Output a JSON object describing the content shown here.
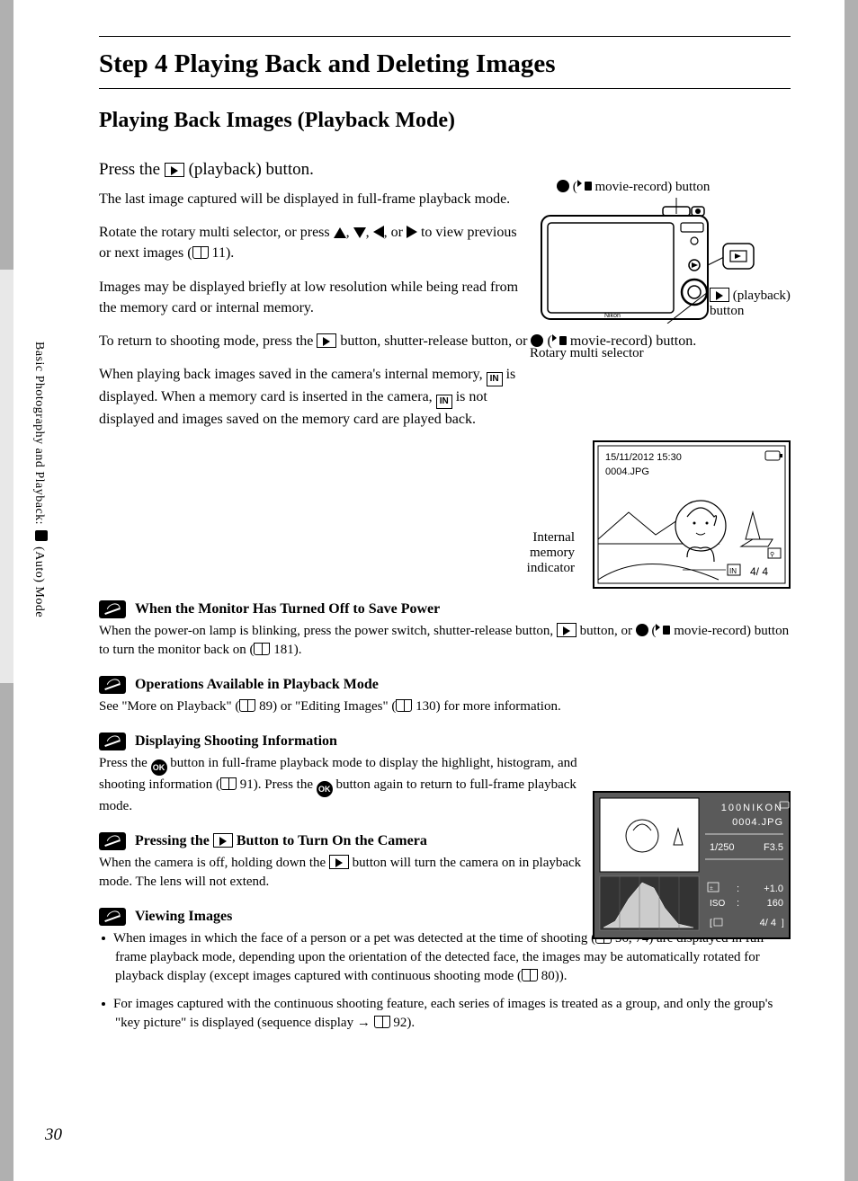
{
  "sidebar_text_1": "Basic Photography and Playback: ",
  "sidebar_text_2": " (Auto) Mode",
  "title": "Step 4 Playing Back and Deleting Images",
  "subtitle": "Playing Back Images (Playback Mode)",
  "step_heading_1": "Press the ",
  "step_heading_2": " (playback) button.",
  "p1": "The last image captured will be displayed in full-frame playback mode.",
  "p2a": "Rotate the rotary multi selector, or press ",
  "p2b": ", or ",
  "p2c": " to view previous or next images (",
  "p2d": " 11).",
  "p3": "Images may be displayed briefly at low resolution while being read from the memory card or internal memory.",
  "p4a": "To return to shooting mode, press the ",
  "p4b": " button, shutter-release button, or ",
  "p4c": " (",
  "p4d": " movie-record) button.",
  "p5a": "When playing back images saved in the camera's internal memory, ",
  "p5b": " is displayed. When a memory card is inserted in the camera, ",
  "p5c": " is not displayed and images saved on the memory card are played back.",
  "diagram": {
    "movie_button_1": " (",
    "movie_button_2": " movie-record) button",
    "playback_button": " (playback) button",
    "rotary_selector": "Rotary multi selector"
  },
  "playback_label": "Internal memory indicator",
  "screen": {
    "datetime": "15/11/2012 15:30",
    "filename": "0004.JPG",
    "counter": "4/   4"
  },
  "note1_title": "When the Monitor Has Turned Off to Save Power",
  "note1_a": "When the power-on lamp is blinking, press the power switch, shutter-release button, ",
  "note1_b": " button, or ",
  "note1_c": " (",
  "note1_d": " movie-record) button to turn the monitor back on (",
  "note1_e": " 181).",
  "note2_title": "Operations Available in Playback Mode",
  "note2_a": "See \"More on Playback\" (",
  "note2_b": " 89) or \"Editing Images\" (",
  "note2_c": " 130) for more information.",
  "note3_title": "Displaying Shooting Information",
  "note3_a": "Press the ",
  "note3_b": " button in full-frame playback mode to display the highlight, histogram, and shooting information (",
  "note3_c": " 91). Press the ",
  "note3_d": " button again to return to full-frame playback mode.",
  "note4_title_a": "Pressing the ",
  "note4_title_b": " Button to Turn On the Camera",
  "note4_a": "When the camera is off, holding down the ",
  "note4_b": " button will turn the camera on in playback mode. The lens will not extend.",
  "note5_title": "Viewing Images",
  "note5_b1a": "When images in which the face of a person or a pet was detected at the time of shooting (",
  "note5_b1b": " 56, 74) are displayed in full-frame playback mode, depending upon the orientation of the detected face, the images may be automatically rotated for playback display (except images captured with continuous shooting mode (",
  "note5_b1c": " 80)).",
  "note5_b2a": "For images captured with the continuous shooting feature, each series of images is treated as a group, and only the group's \"key picture\" is displayed (sequence display → ",
  "note5_b2b": " 92).",
  "histogram": {
    "folder": "100NIKON",
    "filename": "0004.JPG",
    "shutter": "1/250",
    "aperture": "F3.5",
    "ev_label": "",
    "ev": "+1.0",
    "iso_label": "ISO",
    "iso": "160",
    "counter": "4/   4"
  },
  "page_number": "30"
}
